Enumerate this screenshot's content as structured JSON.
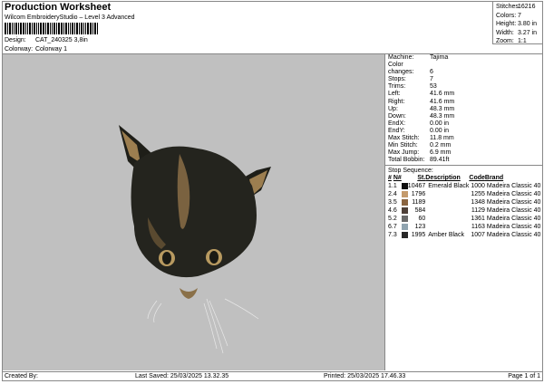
{
  "header": {
    "title": "Production Worksheet",
    "subtitle": "Wilcom EmbroideryStudio – Level 3 Advanced",
    "design_label": "Design:",
    "design_value": "CAT_240325 3,8in",
    "colorway_label": "Colorway:",
    "colorway_value": "Colorway 1"
  },
  "stats": [
    {
      "k": "Stitches:",
      "v": "16216"
    },
    {
      "k": "Colors:",
      "v": "7"
    },
    {
      "k": "Height:",
      "v": "3.80 in"
    },
    {
      "k": "Width:",
      "v": "3.27 in"
    },
    {
      "k": "Zoom:",
      "v": "1:1"
    }
  ],
  "info": [
    {
      "k": "Machine:",
      "v": "Tajima"
    },
    {
      "k": "Color changes:",
      "v": "6"
    },
    {
      "k": "Stops:",
      "v": "7"
    },
    {
      "k": "Trims:",
      "v": "53"
    },
    {
      "k": "Left:",
      "v": "41.6 mm"
    },
    {
      "k": "Right:",
      "v": "41.6 mm"
    },
    {
      "k": "Up:",
      "v": "48.3 mm"
    },
    {
      "k": "Down:",
      "v": "48.3 mm"
    },
    {
      "k": "EndX:",
      "v": "0.00 in"
    },
    {
      "k": "EndY:",
      "v": "0.00 in"
    },
    {
      "k": "Max Stitch:",
      "v": "11.8 mm"
    },
    {
      "k": "Min Stitch:",
      "v": "0.2 mm"
    },
    {
      "k": "Max Jump:",
      "v": "6.9 mm"
    },
    {
      "k": "Total Bobbin:",
      "v": "89.41ft"
    }
  ],
  "stop_sequence": {
    "title": "Stop Sequence:",
    "headers": [
      "#",
      "N#",
      "St.",
      "Description",
      "Code",
      "Brand"
    ],
    "rows": [
      {
        "n": "1.",
        "c": "1",
        "color": "#101010",
        "st": "10467",
        "desc": "Emerald Black",
        "code": "1000",
        "brand": "Madeira Classic 40"
      },
      {
        "n": "2.",
        "c": "4",
        "color": "#c49a6c",
        "st": "1796",
        "desc": "",
        "code": "1255",
        "brand": "Madeira Classic 40"
      },
      {
        "n": "3.",
        "c": "5",
        "color": "#8a6440",
        "st": "1189",
        "desc": "",
        "code": "1348",
        "brand": "Madeira Classic 40"
      },
      {
        "n": "4.",
        "c": "6",
        "color": "#4e4038",
        "st": "584",
        "desc": "",
        "code": "1129",
        "brand": "Madeira Classic 40"
      },
      {
        "n": "5.",
        "c": "2",
        "color": "#6a6a6a",
        "st": "60",
        "desc": "",
        "code": "1361",
        "brand": "Madeira Classic 40"
      },
      {
        "n": "6.",
        "c": "7",
        "color": "#90a4b0",
        "st": "123",
        "desc": "",
        "code": "1163",
        "brand": "Madeira Classic 40"
      },
      {
        "n": "7.",
        "c": "3",
        "color": "#282828",
        "st": "1995",
        "desc": "Amber Black",
        "code": "1007",
        "brand": "Madeira Classic 40"
      }
    ]
  },
  "footer": {
    "created": "Created By:",
    "saved": "Last Saved: 25/03/2025 13.32.35",
    "printed": "Printed: 25/03/2025 17.46.33",
    "page": "Page 1 of 1"
  }
}
